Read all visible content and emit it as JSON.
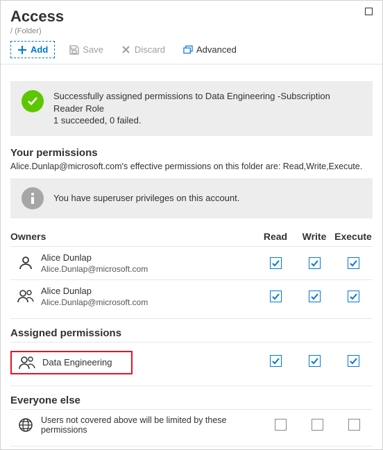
{
  "header": {
    "title": "Access",
    "breadcrumb": "/ (Folder)"
  },
  "toolbar": {
    "add": "Add",
    "save": "Save",
    "discard": "Discard",
    "advanced": "Advanced"
  },
  "successBanner": {
    "line1": "Successfully assigned permissions to Data Engineering -Subscription Reader Role",
    "line2": "1 succeeded, 0 failed."
  },
  "yourPermissions": {
    "title": "Your permissions",
    "desc": "Alice.Dunlap@microsoft.com's effective permissions on this folder are: Read,Write,Execute.",
    "info": "You have superuser privileges on this account."
  },
  "columns": {
    "owners": "Owners",
    "read": "Read",
    "write": "Write",
    "execute": "Execute"
  },
  "owners": [
    {
      "iconType": "user",
      "name": "Alice Dunlap",
      "email": "Alice.Dunlap@microsoft.com",
      "read": true,
      "write": true,
      "execute": true
    },
    {
      "iconType": "group",
      "name": "Alice Dunlap",
      "email": "Alice.Dunlap@microsoft.com",
      "read": true,
      "write": true,
      "execute": true
    }
  ],
  "assigned": {
    "title": "Assigned permissions",
    "items": [
      {
        "iconType": "group",
        "name": "Data Engineering",
        "read": true,
        "write": true,
        "execute": true
      }
    ]
  },
  "everyone": {
    "title": "Everyone else",
    "desc": "Users not covered above will be limited by these permissions",
    "read": false,
    "write": false,
    "execute": false
  }
}
